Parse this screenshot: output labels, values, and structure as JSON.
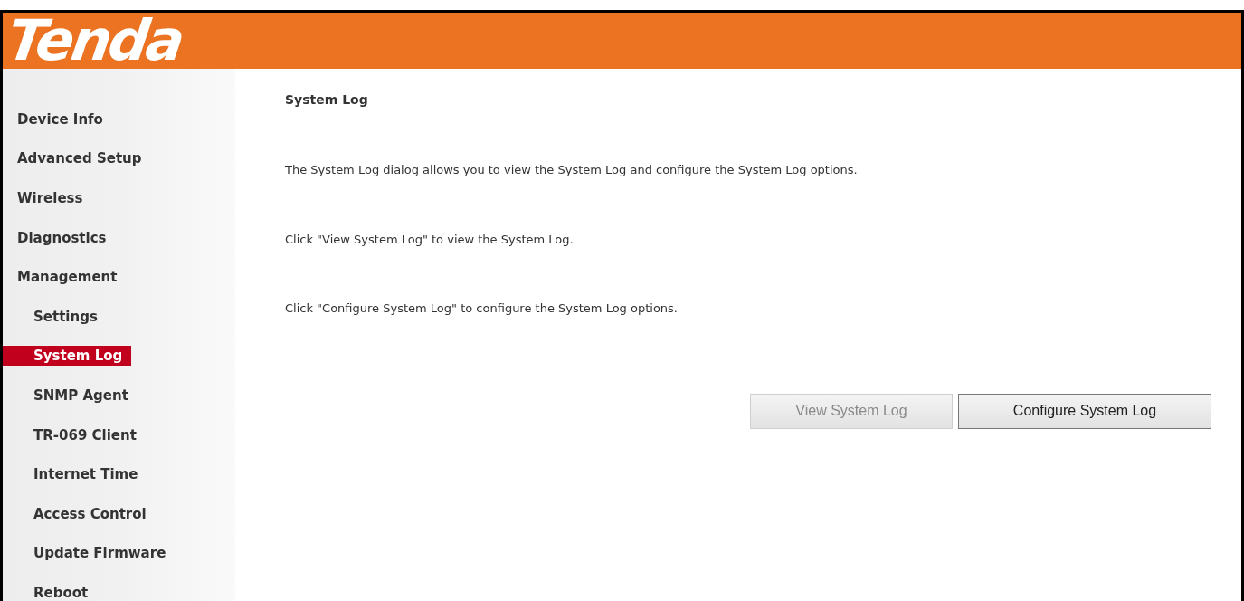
{
  "header": {
    "logo": "Tenda"
  },
  "sidebar": {
    "items": [
      {
        "label": "Device Info",
        "selected": false
      },
      {
        "label": "Advanced Setup",
        "selected": false
      },
      {
        "label": "Wireless",
        "selected": false
      },
      {
        "label": "Diagnostics",
        "selected": false
      },
      {
        "label": "Management",
        "selected": false,
        "children": [
          {
            "label": "Settings",
            "selected": false
          },
          {
            "label": "System Log",
            "selected": true
          },
          {
            "label": "SNMP Agent",
            "selected": false
          },
          {
            "label": "TR-069 Client",
            "selected": false
          },
          {
            "label": "Internet Time",
            "selected": false
          },
          {
            "label": "Access Control",
            "selected": false
          },
          {
            "label": "Update Firmware",
            "selected": false
          },
          {
            "label": "Reboot",
            "selected": false
          }
        ]
      }
    ]
  },
  "content": {
    "title": "System Log",
    "paragraphs": [
      "The System Log dialog allows you to view the System Log and configure the System Log options.",
      "Click \"View System Log\" to view the System Log.",
      "Click \"Configure System Log\" to configure the System Log options."
    ],
    "buttons": [
      {
        "label": "View System Log",
        "disabled": true
      },
      {
        "label": "Configure System Log",
        "disabled": false
      }
    ]
  }
}
